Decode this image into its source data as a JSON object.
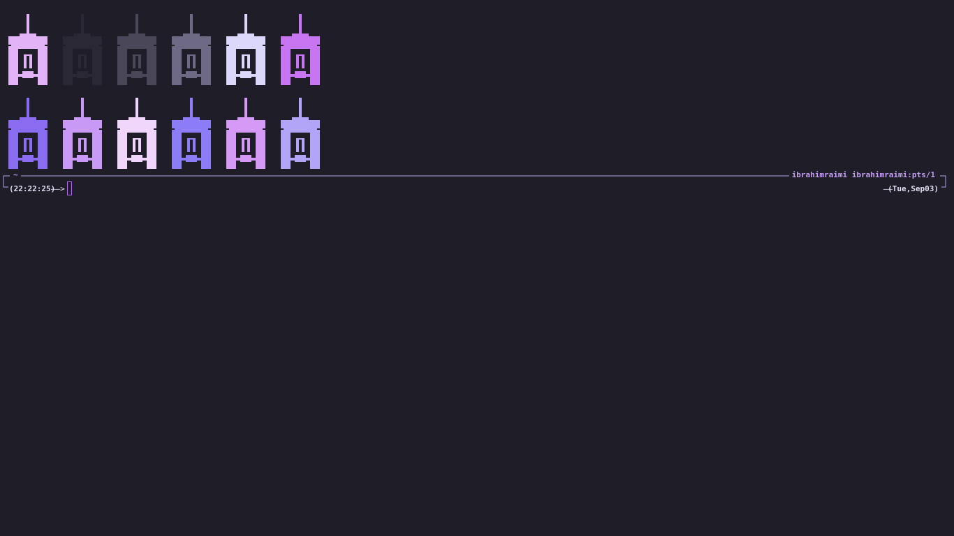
{
  "prompt": {
    "cwd": "~",
    "host": "ibrahimraimi ibrahimraimi:pts/1",
    "time": "(22:22:25)",
    "arrow": "——>",
    "date_dash": "——",
    "date": "(Tue,Sep03)"
  },
  "palette": {
    "row1": [
      "#e3b3f8",
      "#2a2835",
      "#4a4759",
      "#6e6a85",
      "#dcd8fb",
      "#c775f0"
    ],
    "row2": [
      "#8a6cf0",
      "#c99af5",
      "#f0d6fb",
      "#8c7cf6",
      "#d49af6",
      "#b2a4f6"
    ]
  },
  "colors": {
    "background": "#1f1e28",
    "accent": "#c6a0f6",
    "frame": "#b3a1e6",
    "foreground": "#e0def4",
    "cursor": "#b46cf0"
  }
}
